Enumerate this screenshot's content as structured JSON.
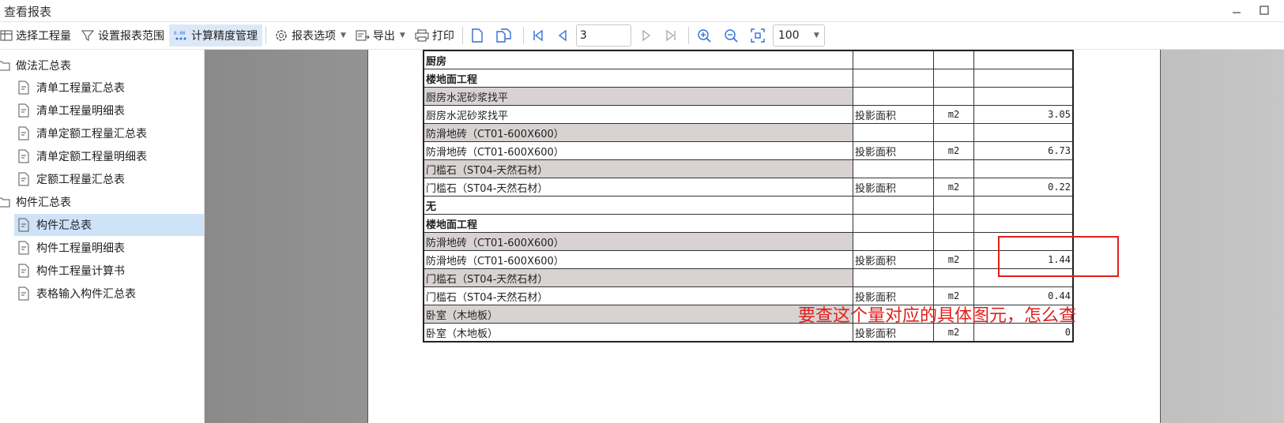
{
  "window": {
    "title": "查看报表"
  },
  "toolbar": {
    "select_qty": "选择工程量",
    "set_range": "设置报表范围",
    "precision": "计算精度管理",
    "report_options": "报表选项",
    "export": "导出",
    "print": "打印",
    "page_value": "3",
    "zoom_value": "100"
  },
  "sidebar": {
    "groups": [
      {
        "label": "做法汇总表",
        "items": [
          "清单工程量汇总表",
          "清单工程量明细表",
          "清单定额工程量汇总表",
          "清单定额工程量明细表",
          "定额工程量汇总表"
        ]
      },
      {
        "label": "构件汇总表",
        "items": [
          "构件汇总表",
          "构件工程量明细表",
          "构件工程量计算书",
          "表格输入构件汇总表"
        ]
      }
    ],
    "selected": "构件汇总表"
  },
  "report": {
    "rows": [
      {
        "c1": "厨房",
        "c2": "",
        "c3": "",
        "c4": "",
        "style": "bold"
      },
      {
        "c1": "楼地面工程",
        "c2": "",
        "c3": "",
        "c4": "",
        "style": "bold"
      },
      {
        "c1": "厨房水泥砂浆找平",
        "c2": "",
        "c3": "",
        "c4": "",
        "style": "gray"
      },
      {
        "c1": "厨房水泥砂浆找平",
        "c2": "投影面积",
        "c3": "m2",
        "c4": "3.05",
        "style": ""
      },
      {
        "c1": "防滑地砖（CT01-600X600）",
        "c2": "",
        "c3": "",
        "c4": "",
        "style": "gray"
      },
      {
        "c1": "防滑地砖（CT01-600X600）",
        "c2": "投影面积",
        "c3": "m2",
        "c4": "6.73",
        "style": ""
      },
      {
        "c1": "门槛石（ST04-天然石材）",
        "c2": "",
        "c3": "",
        "c4": "",
        "style": "gray"
      },
      {
        "c1": "门槛石（ST04-天然石材）",
        "c2": "投影面积",
        "c3": "m2",
        "c4": "0.22",
        "style": ""
      },
      {
        "c1": "无",
        "c2": "",
        "c3": "",
        "c4": "",
        "style": "bold"
      },
      {
        "c1": "楼地面工程",
        "c2": "",
        "c3": "",
        "c4": "",
        "style": "bold"
      },
      {
        "c1": "防滑地砖（CT01-600X600）",
        "c2": "",
        "c3": "",
        "c4": "",
        "style": "gray"
      },
      {
        "c1": "防滑地砖（CT01-600X600）",
        "c2": "投影面积",
        "c3": "m2",
        "c4": "1.44",
        "style": ""
      },
      {
        "c1": "门槛石（ST04-天然石材）",
        "c2": "",
        "c3": "",
        "c4": "",
        "style": "gray"
      },
      {
        "c1": "门槛石（ST04-天然石材）",
        "c2": "投影面积",
        "c3": "m2",
        "c4": "0.44",
        "style": ""
      },
      {
        "c1": "卧室（木地板）",
        "c2": "",
        "c3": "",
        "c4": "",
        "style": "gray"
      },
      {
        "c1": "卧室（木地板）",
        "c2": "投影面积",
        "c3": "m2",
        "c4": "0",
        "style": ""
      }
    ]
  },
  "annotation": {
    "text": "要查这个量对应的具体图元，怎么查"
  },
  "colors": {
    "annotation": "#e0201c",
    "selection": "#cfe3f8",
    "accent_icon": "#2f6fd6"
  }
}
